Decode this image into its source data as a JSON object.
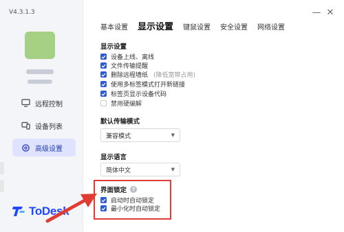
{
  "version": "V4.3.1.3",
  "window_controls": {
    "minimize": "—",
    "close": "✕"
  },
  "sidebar": {
    "items": [
      {
        "label": "远程控制",
        "icon": "monitor-icon"
      },
      {
        "label": "设备列表",
        "icon": "devices-icon"
      },
      {
        "label": "高级设置",
        "icon": "gear-icon",
        "active": true
      }
    ],
    "logo_text": "ToDesk"
  },
  "tabs": [
    {
      "label": "基本设置"
    },
    {
      "label": "显示设置",
      "active": true
    },
    {
      "label": "键鼠设置"
    },
    {
      "label": "安全设置"
    },
    {
      "label": "网络设置"
    }
  ],
  "display_settings": {
    "title": "显示设置",
    "options": [
      {
        "label": "设备上线、离线",
        "checked": true
      },
      {
        "label": "文件传输提醒",
        "checked": true
      },
      {
        "label": "删除远程墙纸",
        "hint": "(降低宽带占用)",
        "checked": true
      },
      {
        "label": "使用多标签模式打开新链接",
        "checked": true
      },
      {
        "label": "标签页显示设备代码",
        "checked": true
      },
      {
        "label": "禁用硬编解",
        "checked": false
      }
    ]
  },
  "transfer_mode": {
    "title": "默认传输模式",
    "value": "兼容模式"
  },
  "language": {
    "title": "显示语言",
    "value": "简体中文"
  },
  "ui_lock": {
    "title": "界面锁定",
    "help": "?",
    "options": [
      {
        "label": "启动时自动锁定",
        "checked": true
      },
      {
        "label": "最小化时自动锁定",
        "checked": true
      }
    ]
  },
  "colors": {
    "accent": "#2d5bd6",
    "highlight": "#e03c34",
    "brand": "#2148ff"
  }
}
